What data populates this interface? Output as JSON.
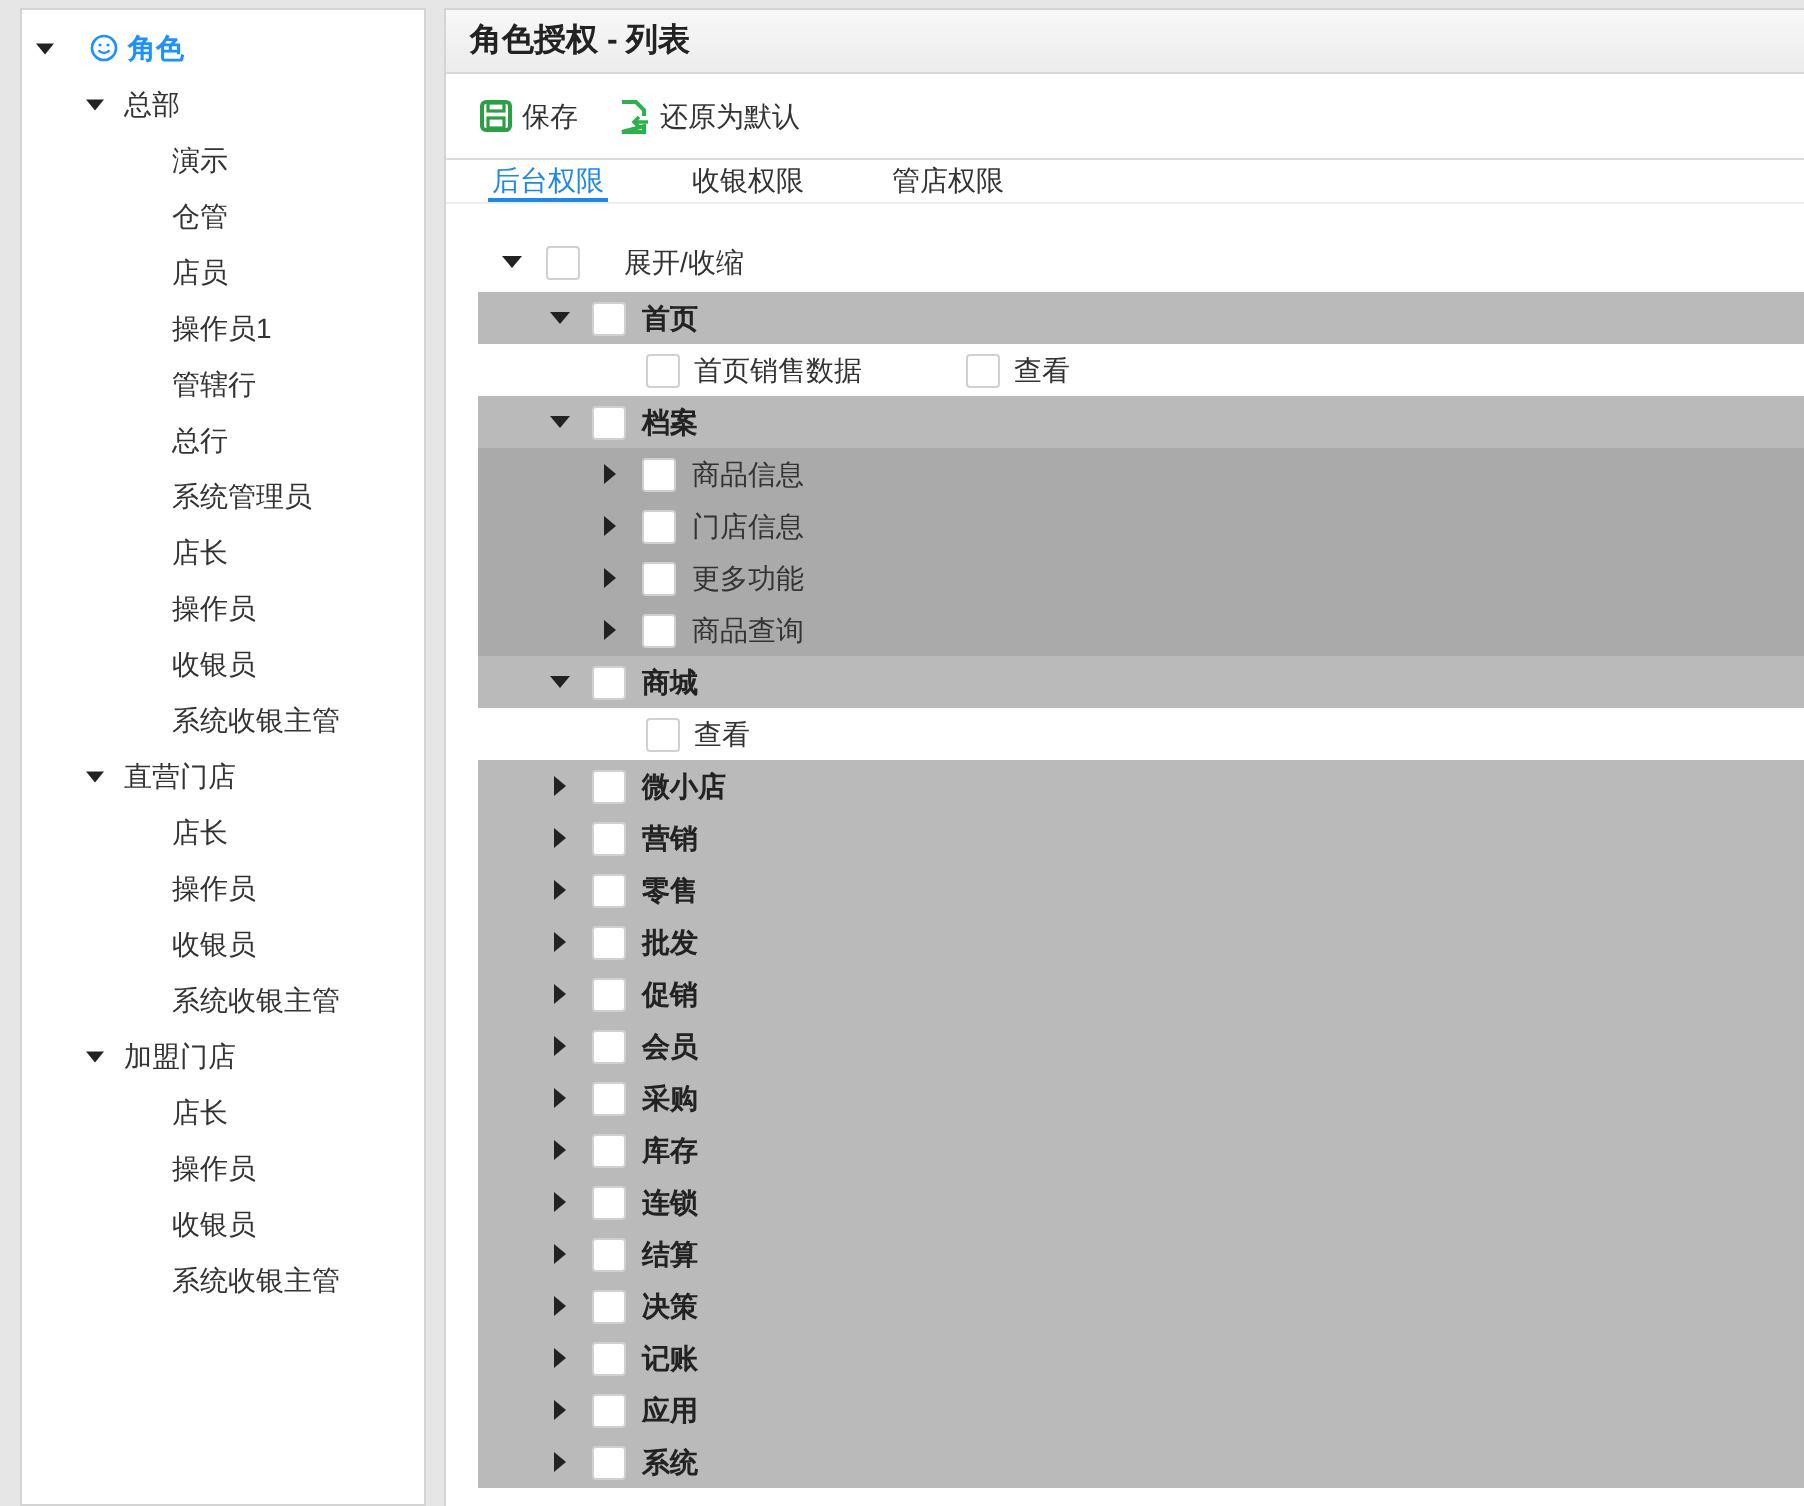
{
  "role_tree": {
    "label": "角色",
    "expanded": true,
    "selected": true,
    "children": [
      {
        "label": "总部",
        "expanded": true,
        "selected": false,
        "children": [
          {
            "label": "演示",
            "selected": false
          },
          {
            "label": "仓管",
            "selected": false
          },
          {
            "label": "店员",
            "selected": false
          },
          {
            "label": "操作员1",
            "selected": false
          },
          {
            "label": "管辖行",
            "selected": false
          },
          {
            "label": "总行",
            "selected": false
          },
          {
            "label": "系统管理员",
            "selected": false
          },
          {
            "label": "店长",
            "selected": false
          },
          {
            "label": "操作员",
            "selected": false
          },
          {
            "label": "收银员",
            "selected": false
          },
          {
            "label": "系统收银主管",
            "selected": false
          }
        ]
      },
      {
        "label": "直营门店",
        "expanded": true,
        "selected": false,
        "children": [
          {
            "label": "店长",
            "selected": false
          },
          {
            "label": "操作员",
            "selected": false
          },
          {
            "label": "收银员",
            "selected": false
          },
          {
            "label": "系统收银主管",
            "selected": false
          }
        ]
      },
      {
        "label": "加盟门店",
        "expanded": true,
        "selected": false,
        "children": [
          {
            "label": "店长",
            "selected": false
          },
          {
            "label": "操作员",
            "selected": false
          },
          {
            "label": "收银员",
            "selected": false
          },
          {
            "label": "系统收银主管",
            "selected": false
          }
        ]
      }
    ]
  },
  "panel": {
    "title": "角色授权 - 列表",
    "toolbar": [
      {
        "kind": "save",
        "label": "保存"
      },
      {
        "kind": "restore",
        "label": "还原为默认"
      }
    ],
    "tabs": [
      {
        "label": "后台权限",
        "selected": true
      },
      {
        "label": "收银权限",
        "selected": false
      },
      {
        "label": "管店权限",
        "selected": false
      }
    ],
    "toggle_all": {
      "label": "展开/收缩",
      "expanded": true,
      "checked": false
    },
    "groups": [
      {
        "label": "首页",
        "expanded": true,
        "checked": false,
        "children": [
          {
            "kind": "leaf",
            "label": "首页销售数据",
            "checked": false
          },
          {
            "kind": "leaf",
            "label": "查看",
            "checked": false
          }
        ]
      },
      {
        "label": "档案",
        "expanded": true,
        "checked": false,
        "children": [
          {
            "kind": "node",
            "label": "商品信息",
            "expanded": false,
            "checked": false
          },
          {
            "kind": "node",
            "label": "门店信息",
            "expanded": false,
            "checked": false
          },
          {
            "kind": "node",
            "label": "更多功能",
            "expanded": false,
            "checked": false
          },
          {
            "kind": "node",
            "label": "商品查询",
            "expanded": false,
            "checked": false
          }
        ]
      },
      {
        "label": "商城",
        "expanded": true,
        "checked": false,
        "children": [
          {
            "kind": "leaf",
            "label": "查看",
            "checked": false
          }
        ]
      },
      {
        "label": "微小店",
        "expanded": false,
        "checked": false
      },
      {
        "label": "营销",
        "expanded": false,
        "checked": false
      },
      {
        "label": "零售",
        "expanded": false,
        "checked": false
      },
      {
        "label": "批发",
        "expanded": false,
        "checked": false
      },
      {
        "label": "促销",
        "expanded": false,
        "checked": false
      },
      {
        "label": "会员",
        "expanded": false,
        "checked": false
      },
      {
        "label": "采购",
        "expanded": false,
        "checked": false
      },
      {
        "label": "库存",
        "expanded": false,
        "checked": false
      },
      {
        "label": "连锁",
        "expanded": false,
        "checked": false
      },
      {
        "label": "结算",
        "expanded": false,
        "checked": false
      },
      {
        "label": "决策",
        "expanded": false,
        "checked": false
      },
      {
        "label": "记账",
        "expanded": false,
        "checked": false
      },
      {
        "label": "应用",
        "expanded": false,
        "checked": false
      },
      {
        "label": "系统",
        "expanded": false,
        "checked": false
      }
    ]
  }
}
